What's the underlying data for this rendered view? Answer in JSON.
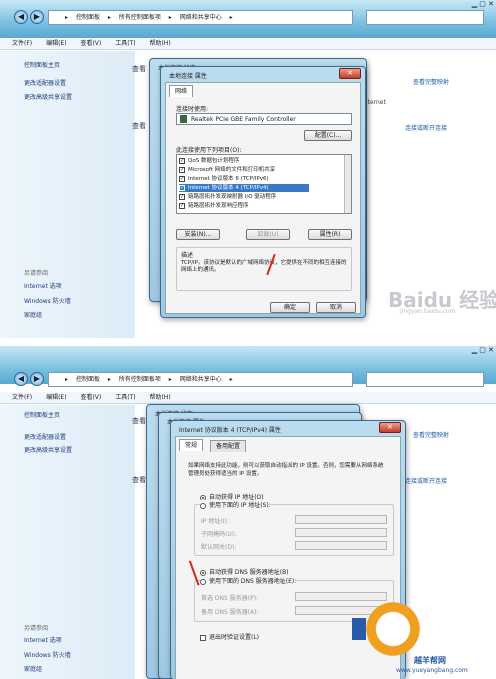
{
  "panel1": {
    "address": {
      "crumbs": [
        "▸",
        "控制面板",
        "▸",
        "所有控制面板项",
        "▸",
        "网络和共享中心",
        "▸"
      ]
    },
    "menu": [
      "文件(F)",
      "编辑(E)",
      "查看(V)",
      "工具(T)",
      "帮助(H)"
    ],
    "sidebar": {
      "home": "控制面板主页",
      "links": [
        "更改适配器设置",
        "更改高级共享设置"
      ],
      "see_also_head": "另请参阅",
      "see_also": [
        "Internet 选项",
        "Windows 防火墙",
        "家庭组"
      ]
    },
    "background": {
      "view1": "查看",
      "view2": "查看",
      "full_map": "查看完整映射",
      "internet": "Internet",
      "connect": "连接或断开连接"
    },
    "dialog_back": {
      "title": "本地连接 状态"
    },
    "dialog": {
      "title": "本地连接 属性",
      "close": "✕",
      "tab_network": "网络",
      "connect_using_label": "连接时使用:",
      "adapter": "Realtek PCIe GBE Family Controller",
      "configure": "配置(C)...",
      "items_label": "此连接使用下列项目(O):",
      "items": [
        {
          "label": "QoS 数据包计划程序",
          "checked": true,
          "selected": false
        },
        {
          "label": "Microsoft 网络的文件和打印机共享",
          "checked": true,
          "selected": false
        },
        {
          "label": "Internet 协议版本 6 (TCP/IPv6)",
          "checked": true,
          "selected": false
        },
        {
          "label": "Internet 协议版本 4 (TCP/IPv4)",
          "checked": true,
          "selected": true
        },
        {
          "label": "链路层拓扑发现映射器 I/O 驱动程序",
          "checked": true,
          "selected": false
        },
        {
          "label": "链路层拓扑发现响应程序",
          "checked": true,
          "selected": false
        }
      ],
      "install": "安装(N)...",
      "uninstall": "卸载(U)",
      "properties": "属性(R)",
      "desc_label": "描述",
      "desc_text": "TCP/IP。该协议是默认的广域网络协议，它提供在不同的相互连接的网络上的通讯。",
      "ok": "确定",
      "cancel": "取消"
    },
    "watermark": "Baidu 经验",
    "watermark_url": "jingyan.baidu.com"
  },
  "panel2": {
    "address": {
      "crumbs": [
        "▸",
        "控制面板",
        "▸",
        "所有控制面板项",
        "▸",
        "网络和共享中心",
        "▸"
      ]
    },
    "menu": [
      "文件(F)",
      "编辑(E)",
      "查看(V)",
      "工具(T)",
      "帮助(H)"
    ],
    "sidebar": {
      "home": "控制面板主页",
      "links": [
        "更改适配器设置",
        "更改高级共享设置"
      ],
      "see_also_head": "另请参阅",
      "see_also": [
        "Internet 选项",
        "Windows 防火墙",
        "家庭组"
      ]
    },
    "background": {
      "view1": "查看",
      "view2": "查看",
      "full_map": "查看完整映射",
      "connect": "连接或断开连接"
    },
    "dialog_back1": {
      "title": "本地连接 状态"
    },
    "dialog_back2": {
      "title": "本地连接 属性"
    },
    "dialog": {
      "title": "Internet 协议版本 4 (TCP/IPv4) 属性",
      "close": "✕",
      "tab_general": "常规",
      "tab_alternate": "备用配置",
      "intro": "如果网络支持此功能，则可以获取自动指派的 IP 设置。否则，您需要从网络系统管理员处获得适当的 IP 设置。",
      "auto_ip": "自动获得 IP 地址(O)",
      "manual_ip": "使用下面的 IP 地址(S):",
      "ip_label": "IP 地址(I):",
      "mask_label": "子网掩码(U):",
      "gateway_label": "默认网关(D):",
      "auto_dns": "自动获得 DNS 服务器地址(B)",
      "manual_dns": "使用下面的 DNS 服务器地址(E):",
      "pref_dns": "首选 DNS 服务器(P):",
      "alt_dns": "备用 DNS 服务器(A):",
      "validate": "退出时验证设置(L)"
    },
    "watermark_url": "www.yueyangbang.com",
    "watermark_cn": "越羊帮网"
  }
}
